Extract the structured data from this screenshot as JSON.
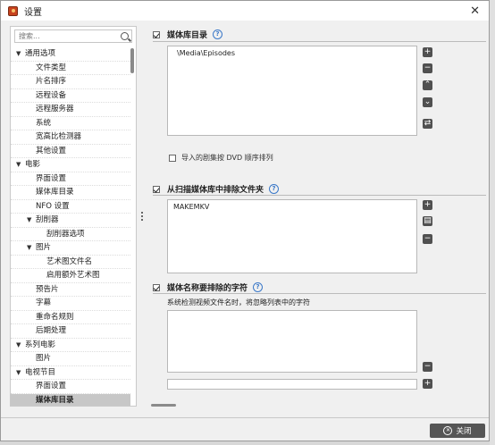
{
  "window": {
    "title": "设置",
    "close_symbol": "✕"
  },
  "search": {
    "placeholder": "搜索..."
  },
  "tree": [
    {
      "label": "通用选项",
      "level": 0,
      "arrow": "▼"
    },
    {
      "label": "文件类型",
      "level": 1
    },
    {
      "label": "片名排序",
      "level": 1
    },
    {
      "label": "远程设备",
      "level": 1
    },
    {
      "label": "远程服务器",
      "level": 1
    },
    {
      "label": "系统",
      "level": 1
    },
    {
      "label": "宽高比检测器",
      "level": 1
    },
    {
      "label": "其他设置",
      "level": 1
    },
    {
      "label": "电影",
      "level": 0,
      "arrow": "▼"
    },
    {
      "label": "界面设置",
      "level": 1
    },
    {
      "label": "媒体库目录",
      "level": 1
    },
    {
      "label": "NFO 设置",
      "level": 1
    },
    {
      "label": "刮削器",
      "level": 1,
      "arrow": "▼"
    },
    {
      "label": "刮削器选项",
      "level": 2
    },
    {
      "label": "图片",
      "level": 1,
      "arrow": "▼"
    },
    {
      "label": "艺术图文件名",
      "level": 2
    },
    {
      "label": "启用额外艺术图",
      "level": 2
    },
    {
      "label": "预告片",
      "level": 1
    },
    {
      "label": "字幕",
      "level": 1
    },
    {
      "label": "重命名规则",
      "level": 1
    },
    {
      "label": "后期处理",
      "level": 1
    },
    {
      "label": "系列电影",
      "level": 0,
      "arrow": "▼"
    },
    {
      "label": "图片",
      "level": 1
    },
    {
      "label": "电视节目",
      "level": 0,
      "arrow": "▼"
    },
    {
      "label": "界面设置",
      "level": 1
    },
    {
      "label": "媒体库目录",
      "level": 1,
      "selected": true
    }
  ],
  "sections": {
    "library": {
      "title": "媒体库目录",
      "help": "?",
      "paths": [
        "\\Media\\Episodes"
      ],
      "dvd_order_label": "导入的剧集按 DVD 顺序排列"
    },
    "exclude_folders": {
      "title": "从扫描媒体库中排除文件夹",
      "help": "?",
      "items": [
        "MAKEMKV"
      ]
    },
    "exclude_chars": {
      "title": "媒体名称要排除的字符",
      "help": "?",
      "description": "系统检测视频文件名时，将忽略列表中的字符",
      "input_value": ""
    }
  },
  "buttons": {
    "add": "+",
    "remove": "−",
    "up": "⌃",
    "down": "⌄",
    "swap": "⇄",
    "file": "▤",
    "close_label": "关闭",
    "close_icon": "✕"
  },
  "colors": {
    "selected_bg": "#c7c7c7",
    "button_dark": "#505050",
    "help_blue": "#3a78c8"
  }
}
